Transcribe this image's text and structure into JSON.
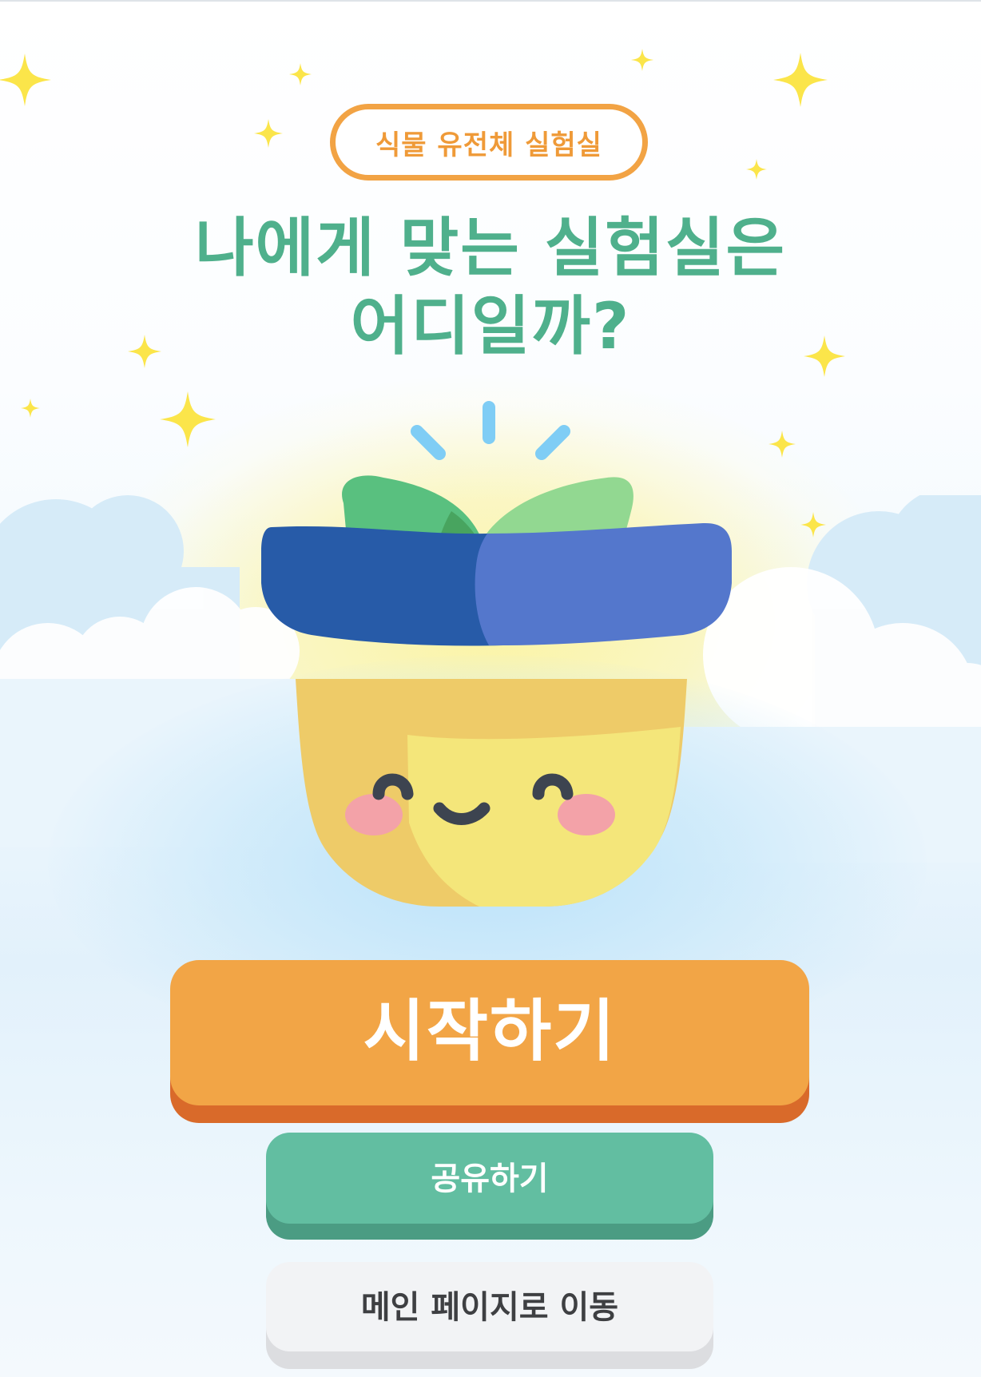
{
  "badge": {
    "label": "식물 유전체 실험실"
  },
  "title": {
    "line1": "나에게 맞는 실험실은",
    "line2": "어디일까?"
  },
  "mascot": {
    "icon": "smiling-plant-pot-icon"
  },
  "buttons": {
    "start": "시작하기",
    "share": "공유하기",
    "main": "메인 페이지로 이동"
  },
  "colors": {
    "accent_orange": "#f2a546",
    "accent_green": "#4fb08c",
    "share_green": "#62bea1",
    "pot_yellow": "#f4e67a",
    "pot_rim_blue": "#5477cc",
    "sparkle_yellow": "#fbe54a"
  }
}
